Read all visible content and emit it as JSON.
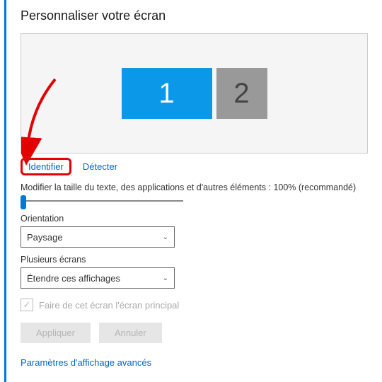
{
  "title": "Personnaliser votre écran",
  "monitors": {
    "m1": "1",
    "m2": "2"
  },
  "links": {
    "identify": "Identifier",
    "detect": "Détecter"
  },
  "scale_label": "Modifier la taille du texte, des applications et d'autres éléments : 100% (recommandé)",
  "orientation": {
    "label": "Orientation",
    "value": "Paysage"
  },
  "multi": {
    "label": "Plusieurs écrans",
    "value": "Étendre ces affichages"
  },
  "make_main": "Faire de cet écran l'écran principal",
  "buttons": {
    "apply": "Appliquer",
    "cancel": "Annuler"
  },
  "advanced": "Paramètres d'affichage avancés",
  "checkmark": "✓",
  "chev": "⌄"
}
